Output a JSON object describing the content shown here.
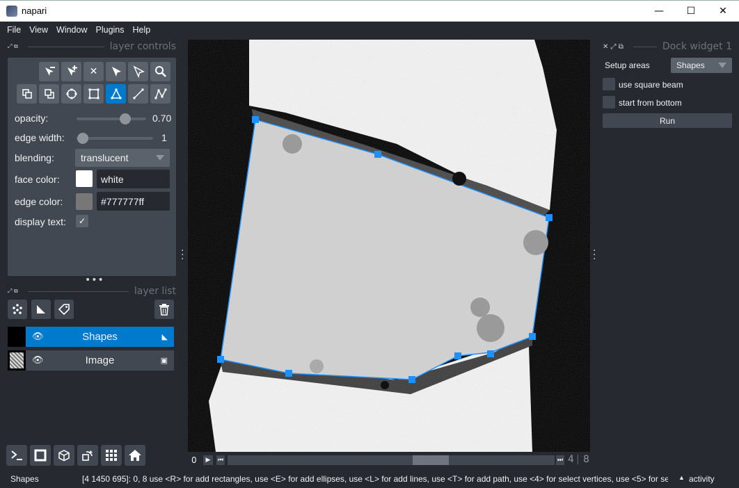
{
  "window": {
    "title": "napari",
    "minimize": "—",
    "maximize": "☐",
    "close": "✕"
  },
  "menu": [
    "File",
    "View",
    "Window",
    "Plugins",
    "Help"
  ],
  "layer_controls": {
    "header": "layer controls",
    "opacity_label": "opacity:",
    "opacity_value": "0.70",
    "opacity_level": 0.7,
    "edge_width_label": "edge width:",
    "edge_width_value": "1",
    "blending_label": "blending:",
    "blending_value": "translucent",
    "face_color_label": "face color:",
    "face_color_value": "white",
    "face_color_swatch": "#ffffff",
    "edge_color_label": "edge color:",
    "edge_color_value": "#777777ff",
    "edge_color_swatch": "#777777",
    "display_text_label": "display text:",
    "display_text_checked": true,
    "tools_row1": [
      "remove-vertex-icon",
      "add-vertex-icon",
      "delete-shape-icon",
      "select-shape-icon",
      "direct-select-icon",
      "pan-zoom-icon"
    ],
    "tools_row2": [
      "move-back-icon",
      "move-front-icon",
      "add-ellipse-icon",
      "add-rectangle-icon",
      "add-polygon-icon",
      "add-line-icon",
      "add-path-icon"
    ],
    "active_tool": "add-polygon-icon"
  },
  "layer_list": {
    "header": "layer list",
    "layers": [
      {
        "name": "Shapes",
        "selected": true
      },
      {
        "name": "Image",
        "selected": false
      }
    ]
  },
  "dims": {
    "start": "0",
    "current": "4",
    "total": "8",
    "position": 0.5
  },
  "status": {
    "layer": "Shapes",
    "message": "[4 1450 695]: 0, 8 use <R> for add rectangles, use <E> for add ellipses, use <L> for add lines, use <T> for add path, use <4> for select vertices, use <5> for sel...",
    "activity": "activity"
  },
  "dock": {
    "header": "Dock widget 1",
    "setup_label": "Setup areas",
    "setup_value": "Shapes",
    "square_beam_label": "use square beam",
    "start_bottom_label": "start from bottom",
    "run_label": "Run"
  },
  "colors": {
    "accent": "#007acc",
    "background": "#262930",
    "panel": "#414851"
  }
}
